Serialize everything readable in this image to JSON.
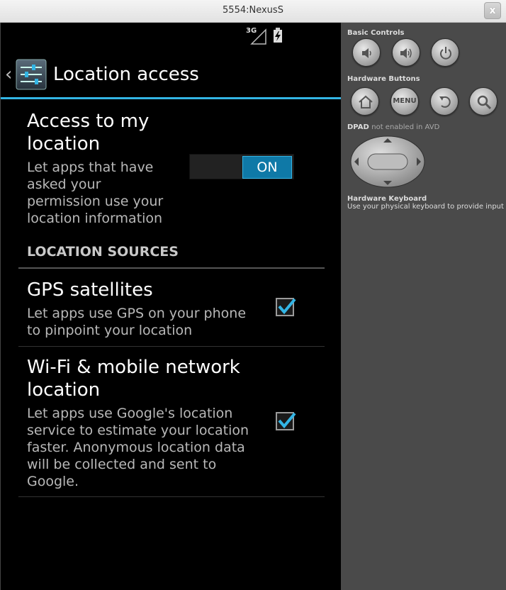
{
  "window": {
    "title": "5554:NexusS",
    "close_glyph": "x"
  },
  "status_bar": {
    "network": "3G"
  },
  "action_bar": {
    "back_glyph": "‹",
    "title": "Location access"
  },
  "access": {
    "title_line1": "Access to my",
    "title_line2": "location",
    "summary": [
      "Let apps that have",
      "asked your",
      "permission use your",
      "location information"
    ],
    "toggle_label": "ON",
    "toggle_state": "on"
  },
  "category": "LOCATION SOURCES",
  "gps": {
    "title": "GPS satellites",
    "summary": [
      "Let apps use GPS on your phone",
      "to pinpoint your location"
    ],
    "checked": true
  },
  "wifi": {
    "title": [
      "Wi-Fi & mobile network",
      "location"
    ],
    "summary": [
      "Let apps use Google's location",
      "service to estimate your location",
      "faster. Anonymous location data",
      "will be collected and sent to",
      "Google."
    ],
    "checked": true
  },
  "panel": {
    "basic_controls": "Basic Controls",
    "hardware_buttons": "Hardware Buttons",
    "menu_label": "MENU",
    "dpad_label": "DPAD",
    "dpad_note": "not enabled in AVD",
    "keyboard_title": "Hardware Keyboard",
    "keyboard_hint": "Use your physical keyboard to provide input"
  },
  "colors": {
    "accent": "#33b5e5",
    "toggle_on": "#0f79a7",
    "panel_bg": "#4a4a4a"
  }
}
